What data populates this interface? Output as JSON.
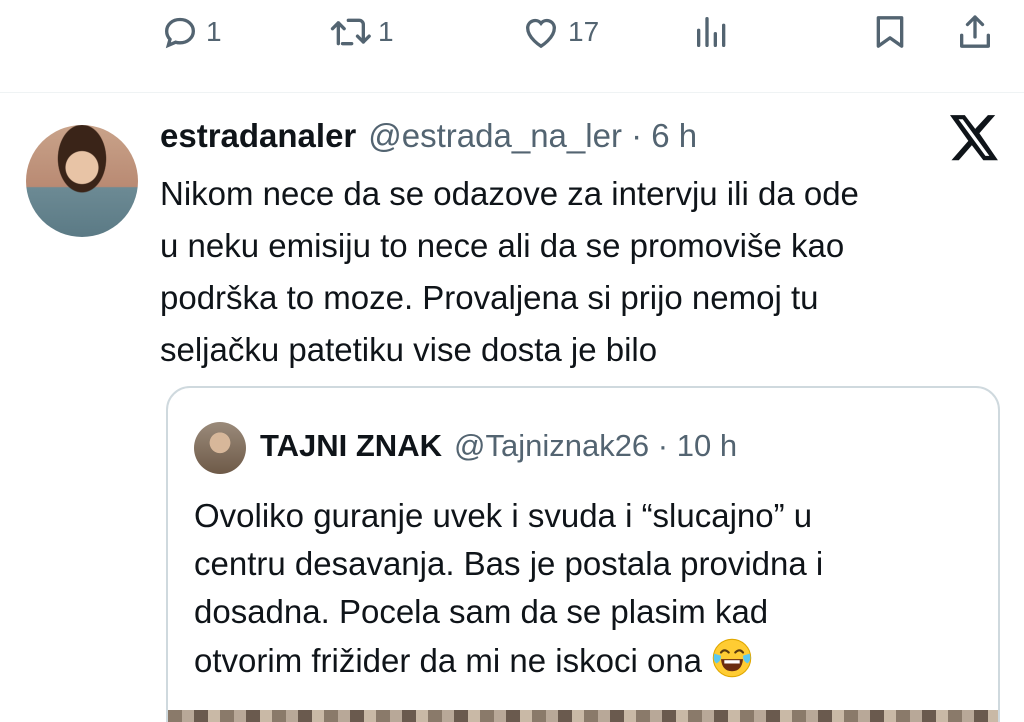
{
  "actions": {
    "reply_count": "1",
    "retweet_count": "1",
    "like_count": "17",
    "icons": [
      "reply-icon",
      "retweet-icon",
      "like-icon",
      "views-icon",
      "bookmark-icon",
      "share-icon"
    ]
  },
  "tweet": {
    "display_name": "estradanaler",
    "handle_time": "@estrada_na_ler · 6 h",
    "lines": [
      "Nikom nece da se odazove za intervju ili da ode",
      "u neku emisiju to nece ali da se promoviše kao",
      "podrška to moze. Provaljena si prijo nemoj tu",
      "seljačku patetiku vise dosta je bilo"
    ]
  },
  "quote": {
    "display_name": "TAJNI ZNAK",
    "handle_time": "@Tajniznak26 · 10 h",
    "lines": [
      "Ovoliko guranje uvek i svuda i  “slucajno” u",
      "centru desavanja. Bas je postala providna i",
      "dosadna. Pocela sam da se plasim kad",
      "otvorim frižider da mi ne iskoci ona"
    ],
    "emoji": "face-with-tears-of-joy"
  },
  "colors": {
    "text": "#0f1419",
    "secondary": "#536471",
    "border": "#cfd9de"
  }
}
